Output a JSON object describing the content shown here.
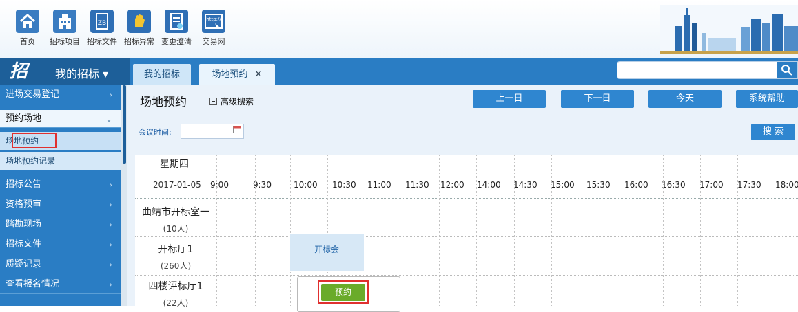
{
  "toolbar": {
    "items": [
      {
        "label": "首页",
        "icon": "home-icon",
        "color": "#3a7cc1"
      },
      {
        "label": "招标项目",
        "icon": "building-icon",
        "color": "#3a7cc1"
      },
      {
        "label": "招标文件",
        "icon": "zb-document-icon",
        "color": "#2f6fb5"
      },
      {
        "label": "招标异常",
        "icon": "hand-stop-icon",
        "color": "#2f6fb5"
      },
      {
        "label": "变更澄清",
        "icon": "edit-document-icon",
        "color": "#2f6fb5"
      },
      {
        "label": "交易网",
        "icon": "web-link-icon",
        "color": "#2f6fb5",
        "badge": "http://"
      }
    ]
  },
  "nav": {
    "brand_logo": "招",
    "brand_title": "我的招标 ▾",
    "tabs": [
      {
        "label": "我的招标"
      },
      {
        "label": "场地预约",
        "close": "✕"
      }
    ],
    "search_placeholder": "",
    "search_icon": "🔍"
  },
  "sidebar": {
    "items": [
      {
        "label": "进场交易登记",
        "chevron": "›"
      },
      {
        "label": "预约场地",
        "chevron": "⌄"
      },
      {
        "label": "招标公告",
        "chevron": "›"
      },
      {
        "label": "资格预审",
        "chevron": "›"
      },
      {
        "label": "踏勘现场",
        "chevron": "›"
      },
      {
        "label": "招标文件",
        "chevron": "›"
      },
      {
        "label": "质疑记录",
        "chevron": "›"
      },
      {
        "label": "查看报名情况",
        "chevron": "›"
      }
    ],
    "subitems": [
      {
        "label": "场地预约"
      },
      {
        "label": "场地预约记录"
      }
    ]
  },
  "page": {
    "title": "场地预约",
    "advanced_search": "高级搜索",
    "buttons": {
      "prev": "上一日",
      "next": "下一日",
      "today": "今天",
      "help": "系统帮助"
    },
    "filter": {
      "label": "会议时间:",
      "value": "",
      "search": "搜 索"
    }
  },
  "schedule": {
    "day": "星期四",
    "date": "2017-01-05",
    "times": [
      "9:00",
      "9:30",
      "10:00",
      "10:30",
      "11:00",
      "11:30",
      "12:00",
      "14:00",
      "14:30",
      "15:00",
      "15:30",
      "16:00",
      "16:30",
      "17:00",
      "17:30",
      "18:00"
    ],
    "rooms": [
      {
        "name": "曲靖市开标室一",
        "capacity": "(10人)"
      },
      {
        "name": "开标厅1",
        "capacity": "(260人)"
      },
      {
        "name": "四楼评标厅1",
        "capacity": "(22人)"
      }
    ],
    "event_label": "开标会",
    "book_button": "预约"
  }
}
